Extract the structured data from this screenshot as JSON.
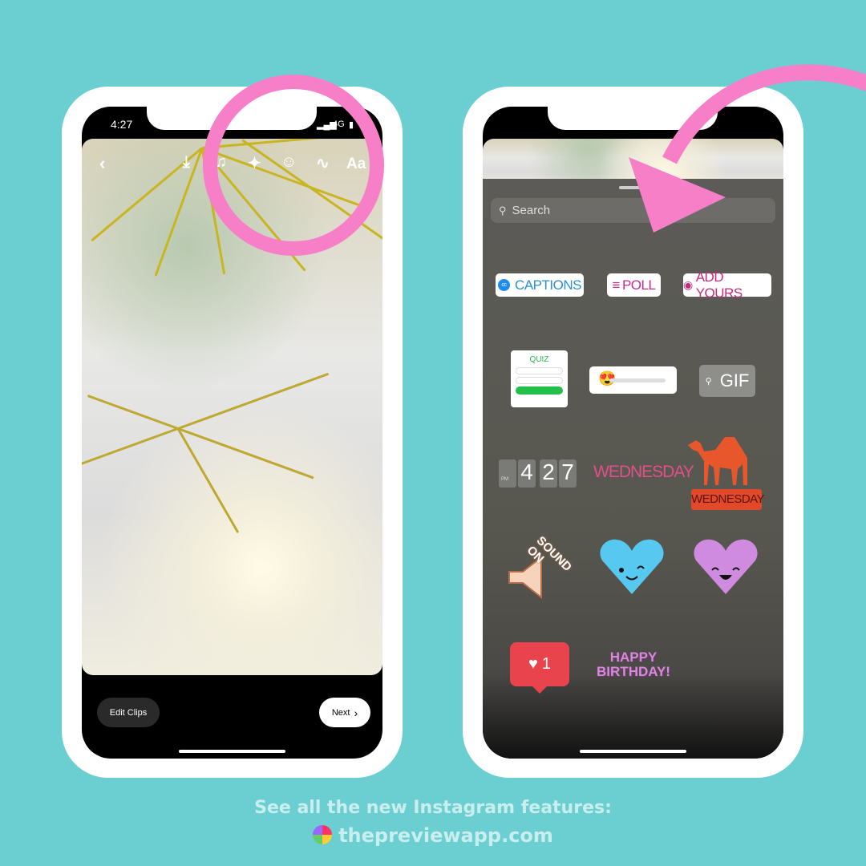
{
  "left_phone": {
    "status": {
      "time": "4:27",
      "network": "4G"
    },
    "toolbar": {
      "back_icon": "chevron-left-icon",
      "icons": [
        "download-icon",
        "music-icon",
        "sparkles-effects-icon",
        "sticker-icon",
        "draw-icon"
      ],
      "text_tool": "Aa"
    },
    "bottom": {
      "edit_clips": "Edit Clips",
      "next": "Next"
    }
  },
  "right_phone": {
    "search_placeholder": "Search",
    "stickers": {
      "captions": "CAPTIONS",
      "poll": "POLL",
      "add_yours": "ADD YOURS",
      "quiz": "QUIZ",
      "gif": "GIF",
      "clock": {
        "ampm": "PM",
        "h": "4",
        "m1": "2",
        "m2": "7"
      },
      "day_text": "WEDNESDAY",
      "camel_day": "WEDNESDAY",
      "sound_on": "SOUND ON",
      "like_count": "1",
      "birthday": "HAPPY BIRTHDAY!"
    }
  },
  "colors": {
    "background": "#6bcfd2",
    "highlight": "#f77fc8"
  },
  "footer": {
    "line1": "See all the new Instagram features:",
    "line2": "thepreviewapp.com"
  }
}
